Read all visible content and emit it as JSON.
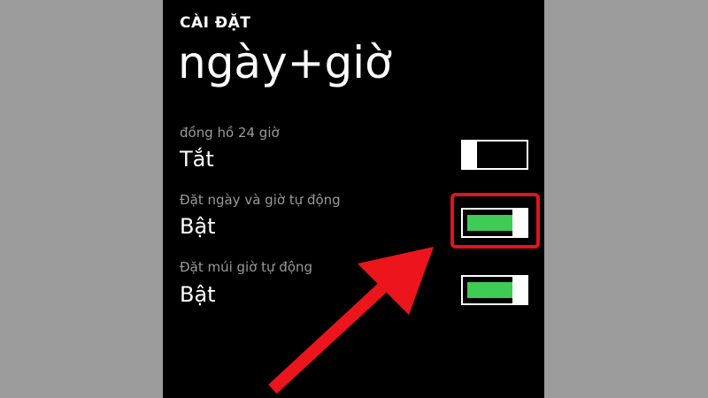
{
  "header": {
    "section_label": "CÀI ĐẶT",
    "page_title": "ngày+giờ"
  },
  "settings": [
    {
      "title": "đồng hồ 24 giờ",
      "value": "Tắt",
      "state": "off"
    },
    {
      "title": "Đặt ngày và giờ tự động",
      "value": "Bật",
      "state": "on"
    },
    {
      "title": "Đặt múi giờ tự động",
      "value": "Bật",
      "state": "on"
    }
  ],
  "colors": {
    "toggle_on": "#3ecb56",
    "highlight": "#e0141b",
    "background": "#000000",
    "subtitle": "#9a9a9a"
  },
  "annotations": {
    "highlight_target": "Đặt ngày và giờ tự động",
    "arrow_icon": "red-arrow-icon"
  }
}
